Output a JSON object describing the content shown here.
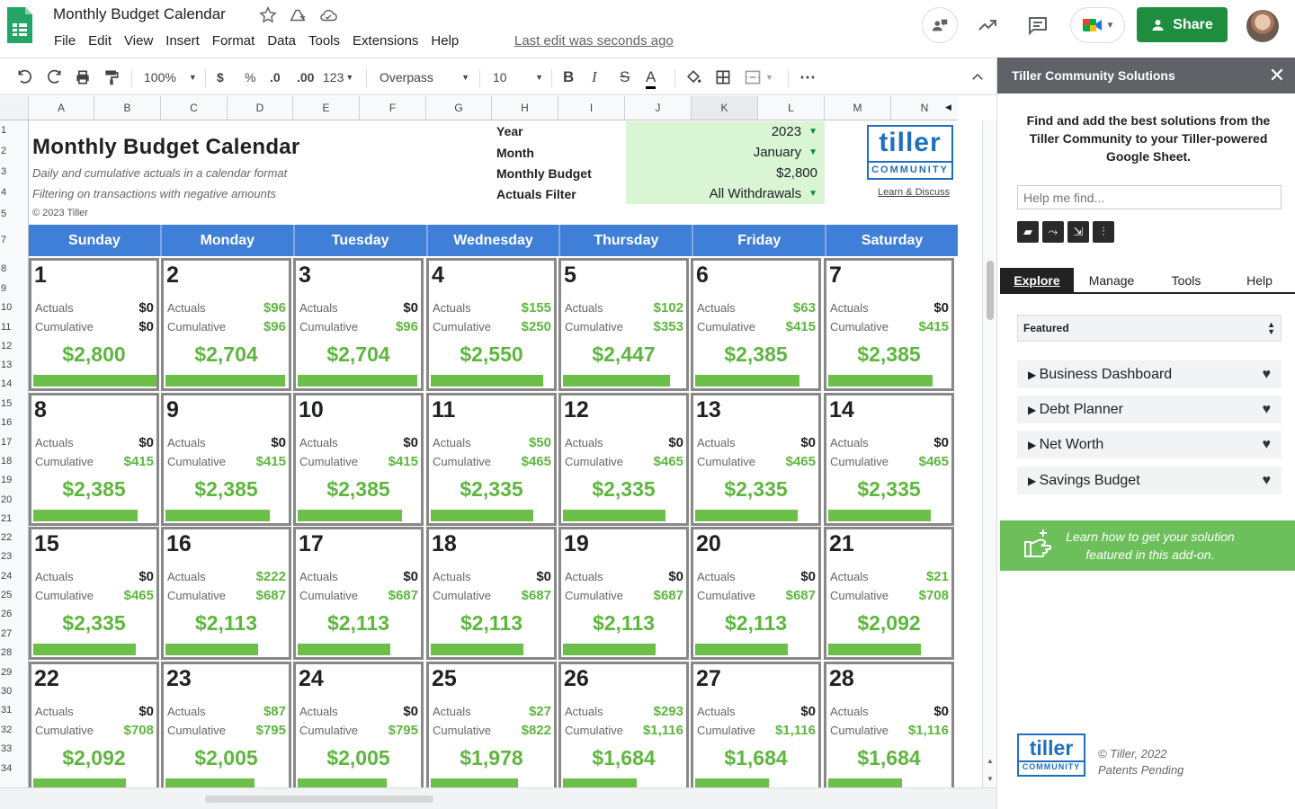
{
  "app": {
    "doc_title": "Monthly Budget Calendar",
    "menu": [
      "File",
      "Edit",
      "View",
      "Insert",
      "Format",
      "Data",
      "Tools",
      "Extensions",
      "Help"
    ],
    "last_edit": "Last edit was seconds ago",
    "share_label": "Share"
  },
  "toolbar": {
    "zoom": "100%",
    "currency": "$",
    "percent": "%",
    "dec_less": ".0",
    "dec_more": ".00",
    "format_more": "123",
    "font": "Overpass",
    "font_size": "10",
    "bold": "B",
    "italic": "I",
    "strike": "S",
    "text_color": "A",
    "more": "⋯"
  },
  "grid": {
    "columns": [
      "A",
      "B",
      "C",
      "D",
      "E",
      "F",
      "G",
      "H",
      "I",
      "J",
      "K",
      "L",
      "M",
      "N"
    ],
    "rows": [
      "1",
      "2",
      "3",
      "4",
      "5",
      "7",
      "8",
      "9",
      "10",
      "11",
      "12",
      "13",
      "14",
      "15",
      "16",
      "17",
      "18",
      "19",
      "20",
      "21",
      "22",
      "23",
      "24",
      "25",
      "26",
      "27",
      "28",
      "29",
      "30",
      "31",
      "32",
      "33",
      "34"
    ]
  },
  "sheet": {
    "title": "Monthly Budget Calendar",
    "subtitle1": "Daily and cumulative actuals in a calendar format",
    "subtitle2": "Filtering on transactions with negative amounts",
    "copyright": "© 2023 Tiller",
    "params": [
      {
        "label": "Year",
        "value": "2023",
        "dropdown": true
      },
      {
        "label": "Month",
        "value": "January",
        "dropdown": true
      },
      {
        "label": "Monthly Budget",
        "value": "$2,800",
        "dropdown": false
      },
      {
        "label": "Actuals Filter",
        "value": "All Withdrawals",
        "dropdown": true
      }
    ],
    "logo_word": "tiller",
    "logo_tag": "COMMUNITY",
    "learn_link": "Learn & Discuss",
    "days": [
      "Sunday",
      "Monday",
      "Tuesday",
      "Wednesday",
      "Thursday",
      "Friday",
      "Saturday"
    ],
    "actuals_label": "Actuals",
    "cumulative_label": "Cumulative"
  },
  "calendar": [
    {
      "day": "1",
      "actual": "$0",
      "cum": "$0",
      "remaining": "$2,800",
      "bar": 1.0
    },
    {
      "day": "2",
      "actual": "$96",
      "cum": "$96",
      "remaining": "$2,704",
      "bar": 0.97
    },
    {
      "day": "3",
      "actual": "$0",
      "cum": "$96",
      "remaining": "$2,704",
      "bar": 0.97
    },
    {
      "day": "4",
      "actual": "$155",
      "cum": "$250",
      "remaining": "$2,550",
      "bar": 0.91
    },
    {
      "day": "5",
      "actual": "$102",
      "cum": "$353",
      "remaining": "$2,447",
      "bar": 0.87
    },
    {
      "day": "6",
      "actual": "$63",
      "cum": "$415",
      "remaining": "$2,385",
      "bar": 0.85
    },
    {
      "day": "7",
      "actual": "$0",
      "cum": "$415",
      "remaining": "$2,385",
      "bar": 0.85
    },
    {
      "day": "8",
      "actual": "$0",
      "cum": "$415",
      "remaining": "$2,385",
      "bar": 0.85
    },
    {
      "day": "9",
      "actual": "$0",
      "cum": "$415",
      "remaining": "$2,385",
      "bar": 0.85
    },
    {
      "day": "10",
      "actual": "$0",
      "cum": "$415",
      "remaining": "$2,385",
      "bar": 0.85
    },
    {
      "day": "11",
      "actual": "$50",
      "cum": "$465",
      "remaining": "$2,335",
      "bar": 0.83
    },
    {
      "day": "12",
      "actual": "$0",
      "cum": "$465",
      "remaining": "$2,335",
      "bar": 0.83
    },
    {
      "day": "13",
      "actual": "$0",
      "cum": "$465",
      "remaining": "$2,335",
      "bar": 0.83
    },
    {
      "day": "14",
      "actual": "$0",
      "cum": "$465",
      "remaining": "$2,335",
      "bar": 0.83
    },
    {
      "day": "15",
      "actual": "$0",
      "cum": "$465",
      "remaining": "$2,335",
      "bar": 0.83
    },
    {
      "day": "16",
      "actual": "$222",
      "cum": "$687",
      "remaining": "$2,113",
      "bar": 0.75
    },
    {
      "day": "17",
      "actual": "$0",
      "cum": "$687",
      "remaining": "$2,113",
      "bar": 0.75
    },
    {
      "day": "18",
      "actual": "$0",
      "cum": "$687",
      "remaining": "$2,113",
      "bar": 0.75
    },
    {
      "day": "19",
      "actual": "$0",
      "cum": "$687",
      "remaining": "$2,113",
      "bar": 0.75
    },
    {
      "day": "20",
      "actual": "$0",
      "cum": "$687",
      "remaining": "$2,113",
      "bar": 0.75
    },
    {
      "day": "21",
      "actual": "$21",
      "cum": "$708",
      "remaining": "$2,092",
      "bar": 0.75
    },
    {
      "day": "22",
      "actual": "$0",
      "cum": "$708",
      "remaining": "$2,092",
      "bar": 0.75
    },
    {
      "day": "23",
      "actual": "$87",
      "cum": "$795",
      "remaining": "$2,005",
      "bar": 0.72
    },
    {
      "day": "24",
      "actual": "$0",
      "cum": "$795",
      "remaining": "$2,005",
      "bar": 0.72
    },
    {
      "day": "25",
      "actual": "$27",
      "cum": "$822",
      "remaining": "$1,978",
      "bar": 0.71
    },
    {
      "day": "26",
      "actual": "$293",
      "cum": "$1,116",
      "remaining": "$1,684",
      "bar": 0.6
    },
    {
      "day": "27",
      "actual": "$0",
      "cum": "$1,116",
      "remaining": "$1,684",
      "bar": 0.6
    },
    {
      "day": "28",
      "actual": "$0",
      "cum": "$1,116",
      "remaining": "$1,684",
      "bar": 0.6
    }
  ],
  "sidebar": {
    "title": "Tiller Community Solutions",
    "intro": "Find and add the best solutions from the Tiller Community to your Tiller-powered Google Sheet.",
    "search_placeholder": "Help me find...",
    "tabs": [
      "Explore",
      "Manage",
      "Tools",
      "Help"
    ],
    "filter": "Featured",
    "solutions": [
      "Business Dashboard",
      "Debt Planner",
      "Net Worth",
      "Savings Budget"
    ],
    "promo": "Learn how to get your solution featured in this add-on.",
    "foot_word": "tiller",
    "foot_tag": "COMMUNITY",
    "foot_copy": "© Tiller, 2022",
    "foot_patent": "Patents Pending"
  },
  "colors": {
    "accent": "#3f7fd8",
    "green": "#5eb63e",
    "share": "#1e8e3e",
    "param_bg": "#d9f5d3"
  }
}
